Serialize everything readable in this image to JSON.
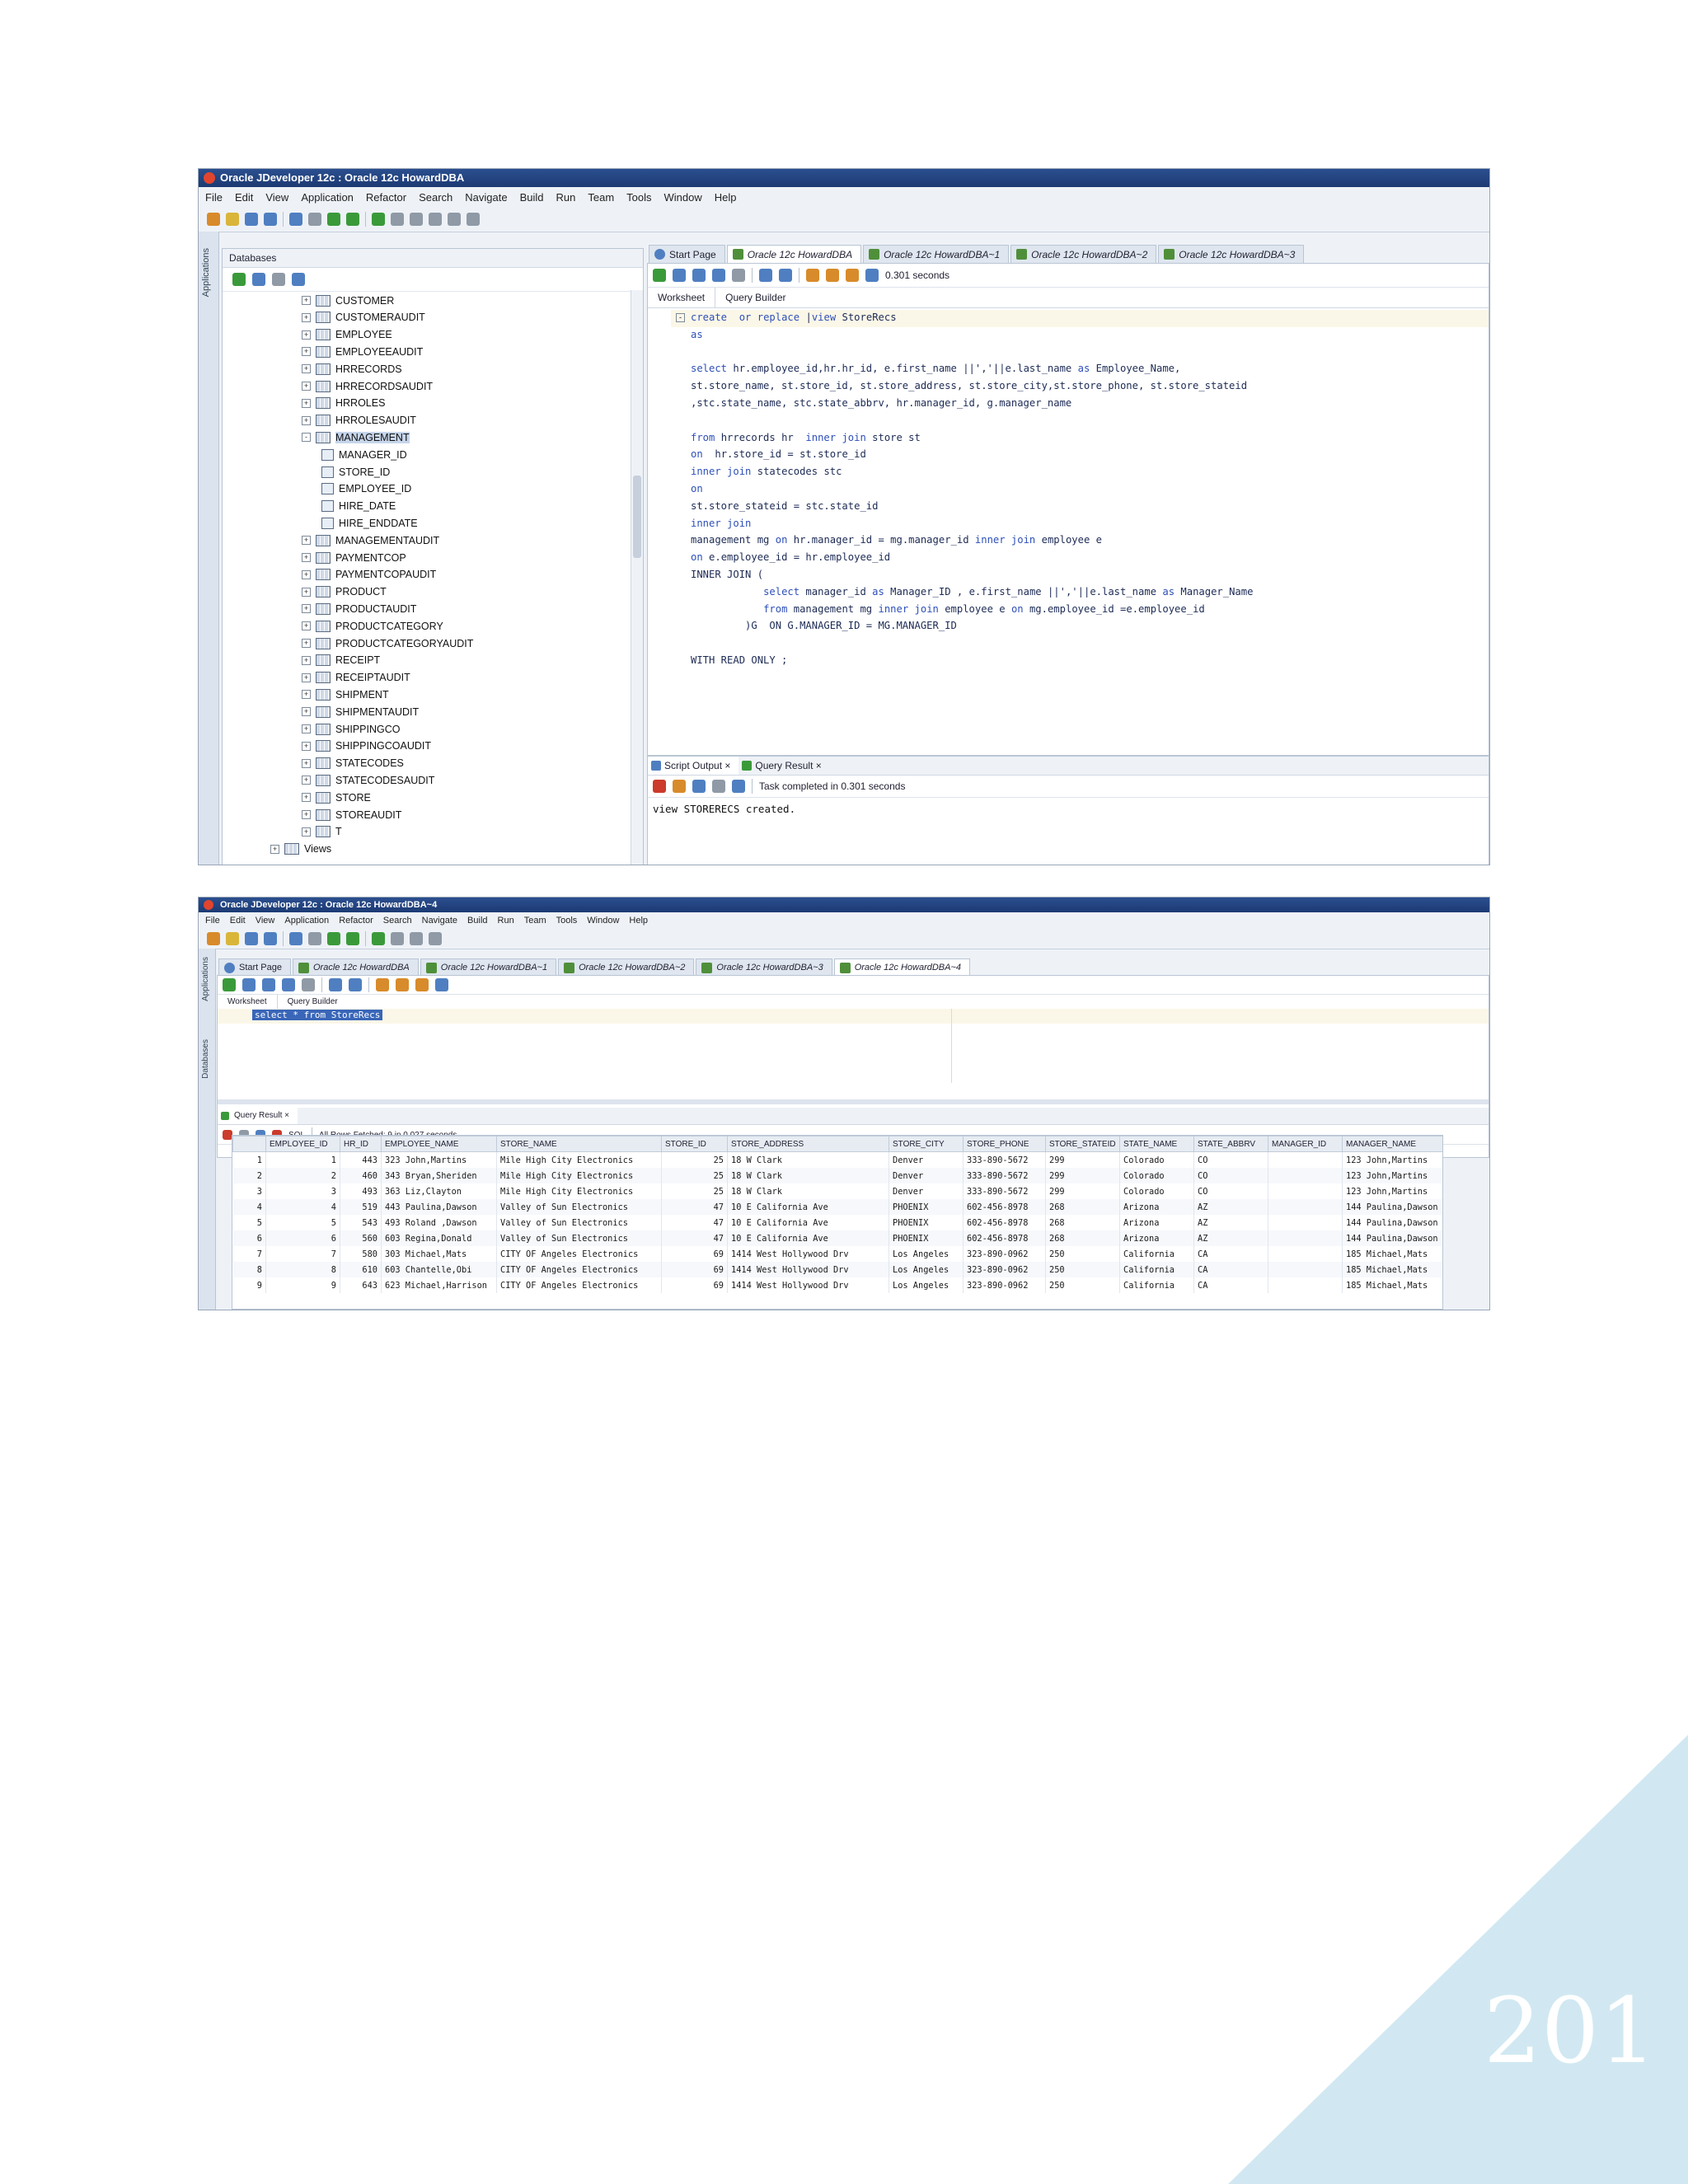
{
  "colors": {
    "titlebar": "#1c3a73",
    "corner_triangle": "#d1e8f2",
    "page_number": "#ffffff"
  },
  "page_number": "201",
  "window1": {
    "title": "Oracle JDeveloper 12c : Oracle 12c HowardDBA",
    "menu": [
      "File",
      "Edit",
      "View",
      "Application",
      "Refactor",
      "Search",
      "Navigate",
      "Build",
      "Run",
      "Team",
      "Tools",
      "Window",
      "Help"
    ],
    "rail_tab": "Applications",
    "databases_label": "Databases",
    "tree": [
      {
        "label": "CUSTOMER",
        "type": "table",
        "expand": "+"
      },
      {
        "label": "CUSTOMERAUDIT",
        "type": "table",
        "expand": "+"
      },
      {
        "label": "EMPLOYEE",
        "type": "table",
        "expand": "+"
      },
      {
        "label": "EMPLOYEEAUDIT",
        "type": "table",
        "expand": "+"
      },
      {
        "label": "HRRECORDS",
        "type": "table",
        "expand": "+"
      },
      {
        "label": "HRRECORDSAUDIT",
        "type": "table",
        "expand": "+"
      },
      {
        "label": "HRROLES",
        "type": "table",
        "expand": "+"
      },
      {
        "label": "HRROLESAUDIT",
        "type": "table",
        "expand": "+"
      },
      {
        "label": "MANAGEMENT",
        "type": "table",
        "expand": "-",
        "selected": true
      },
      {
        "label": "MANAGER_ID",
        "type": "column"
      },
      {
        "label": "STORE_ID",
        "type": "column"
      },
      {
        "label": "EMPLOYEE_ID",
        "type": "column"
      },
      {
        "label": "HIRE_DATE",
        "type": "column"
      },
      {
        "label": "HIRE_ENDDATE",
        "type": "column"
      },
      {
        "label": "MANAGEMENTAUDIT",
        "type": "table",
        "expand": "+"
      },
      {
        "label": "PAYMENTCOP",
        "type": "table",
        "expand": "+"
      },
      {
        "label": "PAYMENTCOPAUDIT",
        "type": "table",
        "expand": "+"
      },
      {
        "label": "PRODUCT",
        "type": "table",
        "expand": "+"
      },
      {
        "label": "PRODUCTAUDIT",
        "type": "table",
        "expand": "+"
      },
      {
        "label": "PRODUCTCATEGORY",
        "type": "table",
        "expand": "+"
      },
      {
        "label": "PRODUCTCATEGORYAUDIT",
        "type": "table",
        "expand": "+"
      },
      {
        "label": "RECEIPT",
        "type": "table",
        "expand": "+"
      },
      {
        "label": "RECEIPTAUDIT",
        "type": "table",
        "expand": "+"
      },
      {
        "label": "SHIPMENT",
        "type": "table",
        "expand": "+"
      },
      {
        "label": "SHIPMENTAUDIT",
        "type": "table",
        "expand": "+"
      },
      {
        "label": "SHIPPINGCO",
        "type": "table",
        "expand": "+"
      },
      {
        "label": "SHIPPINGCOAUDIT",
        "type": "table",
        "expand": "+"
      },
      {
        "label": "STATECODES",
        "type": "table",
        "expand": "+"
      },
      {
        "label": "STATECODESAUDIT",
        "type": "table",
        "expand": "+"
      },
      {
        "label": "STORE",
        "type": "table",
        "expand": "+"
      },
      {
        "label": "STOREAUDIT",
        "type": "table",
        "expand": "+"
      },
      {
        "label": "T",
        "type": "table",
        "expand": "+"
      },
      {
        "label": "Views",
        "type": "folder",
        "expand": "+"
      }
    ],
    "tabs": [
      "Start Page",
      "Oracle 12c HowardDBA",
      "Oracle 12c HowardDBA~1",
      "Oracle 12c HowardDBA~2",
      "Oracle 12c HowardDBA~3"
    ],
    "timing": "0.301 seconds",
    "subtabs": [
      "Worksheet",
      "Query Builder"
    ],
    "code": [
      "create  or replace |view StoreRecs",
      "as",
      "",
      "select hr.employee_id,hr.hr_id, e.first_name ||','||e.last_name as Employee_Name,",
      "st.store_name, st.store_id, st.store_address, st.store_city,st.store_phone, st.store_stateid",
      ",stc.state_name, stc.state_abbrv, hr.manager_id, g.manager_name",
      "",
      "from hrrecords hr  inner join store st",
      "on  hr.store_id = st.store_id",
      "inner join statecodes stc",
      "on",
      "st.store_stateid = stc.state_id",
      "inner join",
      "management mg on hr.manager_id = mg.manager_id inner join employee e",
      "on e.employee_id = hr.employee_id",
      "INNER JOIN (",
      "            select manager_id as Manager_ID , e.first_name ||','||e.last_name as Manager_Name",
      "            from management mg inner join employee e on mg.employee_id =e.employee_id",
      "         )G  ON G.MANAGER_ID = MG.MANAGER_ID",
      "",
      "WITH READ ONLY ;"
    ],
    "output_tabs": [
      "Script Output",
      "Query Result"
    ],
    "task_status": "Task completed in 0.301 seconds",
    "output_text": "view STORERECS created."
  },
  "window2": {
    "title": "Oracle JDeveloper 12c : Oracle 12c HowardDBA~4",
    "menu": [
      "File",
      "Edit",
      "View",
      "Application",
      "Refactor",
      "Search",
      "Navigate",
      "Build",
      "Run",
      "Team",
      "Tools",
      "Window",
      "Help"
    ],
    "rail_tabs": [
      "Applications",
      "Databases"
    ],
    "tabs": [
      "Start Page",
      "Oracle 12c HowardDBA",
      "Oracle 12c HowardDBA~1",
      "Oracle 12c HowardDBA~2",
      "Oracle 12c HowardDBA~3",
      "Oracle 12c HowardDBA~4"
    ],
    "subtabs": [
      "Worksheet",
      "Query Builder"
    ],
    "query": "select * from StoreRecs",
    "result_tab": "Query Result",
    "fetch_status": "All Rows Fetched: 9 in 0.027 seconds",
    "sql_label": "SQL",
    "columns": [
      "EMPLOYEE_ID",
      "HR_ID",
      "EMPLOYEE_NAME",
      "STORE_NAME",
      "STORE_ID",
      "STORE_ADDRESS",
      "STORE_CITY",
      "STORE_PHONE",
      "STORE_STATEID",
      "STATE_NAME",
      "STATE_ABBRV",
      "MANAGER_ID",
      "MANAGER_NAME"
    ],
    "rows": [
      [
        "1",
        "443",
        "323 John,Martins",
        "Mile High City Electronics",
        "25",
        "18 W Clark",
        "Denver",
        "333-890-5672",
        "299",
        "Colorado",
        "CO",
        "",
        "123 John,Martins"
      ],
      [
        "2",
        "460",
        "343 Bryan,Sheriden",
        "Mile High City Electronics",
        "25",
        "18 W Clark",
        "Denver",
        "333-890-5672",
        "299",
        "Colorado",
        "CO",
        "",
        "123 John,Martins"
      ],
      [
        "3",
        "493",
        "363 Liz,Clayton",
        "Mile High City Electronics",
        "25",
        "18 W Clark",
        "Denver",
        "333-890-5672",
        "299",
        "Colorado",
        "CO",
        "",
        "123 John,Martins"
      ],
      [
        "4",
        "519",
        "443 Paulina,Dawson",
        "Valley of Sun Electronics",
        "47",
        "10 E California Ave",
        "PHOENIX",
        "602-456-8978",
        "268",
        "Arizona",
        "AZ",
        "",
        "144 Paulina,Dawson"
      ],
      [
        "5",
        "543",
        "493 Roland ,Dawson",
        "Valley of Sun Electronics",
        "47",
        "10 E California Ave",
        "PHOENIX",
        "602-456-8978",
        "268",
        "Arizona",
        "AZ",
        "",
        "144 Paulina,Dawson"
      ],
      [
        "6",
        "560",
        "603 Regina,Donald",
        "Valley of Sun Electronics",
        "47",
        "10 E California Ave",
        "PHOENIX",
        "602-456-8978",
        "268",
        "Arizona",
        "AZ",
        "",
        "144 Paulina,Dawson"
      ],
      [
        "7",
        "580",
        "303 Michael,Mats",
        "CITY OF Angeles Electronics",
        "69",
        "1414 West Hollywood Drv",
        "Los Angeles",
        "323-890-0962",
        "250",
        "California",
        "CA",
        "",
        "185 Michael,Mats"
      ],
      [
        "8",
        "610",
        "603 Chantelle,Obi",
        "CITY OF Angeles Electronics",
        "69",
        "1414 West Hollywood Drv",
        "Los Angeles",
        "323-890-0962",
        "250",
        "California",
        "CA",
        "",
        "185 Michael,Mats"
      ],
      [
        "9",
        "643",
        "623 Michael,Harrison",
        "CITY OF Angeles Electronics",
        "69",
        "1414 West Hollywood Drv",
        "Los Angeles",
        "323-890-0962",
        "250",
        "California",
        "CA",
        "",
        "185 Michael,Mats"
      ]
    ]
  }
}
